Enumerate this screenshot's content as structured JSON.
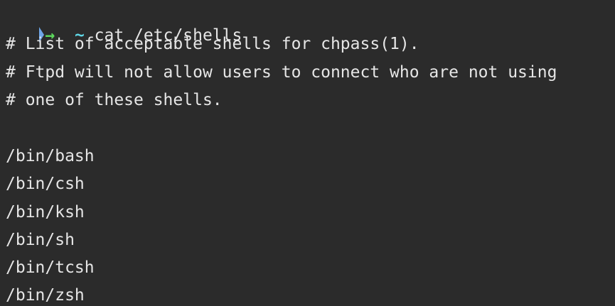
{
  "prompt": {
    "arrow": "→",
    "cwd": "~",
    "command": "cat /etc/shells"
  },
  "output": {
    "comments": [
      "# List of acceptable shells for chpass(1).",
      "# Ftpd will not allow users to connect who are not using",
      "# one of these shells."
    ],
    "shells": [
      "/bin/bash",
      "/bin/csh",
      "/bin/ksh",
      "/bin/sh",
      "/bin/tcsh",
      "/bin/zsh"
    ]
  },
  "colors": {
    "background": "#2b2b2b",
    "text": "#e6e6e6",
    "prompt_arrow": "#5cd65c",
    "prompt_cwd": "#5fd7e6",
    "edge_marker": "#6fa6e8"
  },
  "icons": {
    "edge_marker": "prompt-edge-marker-icon"
  }
}
